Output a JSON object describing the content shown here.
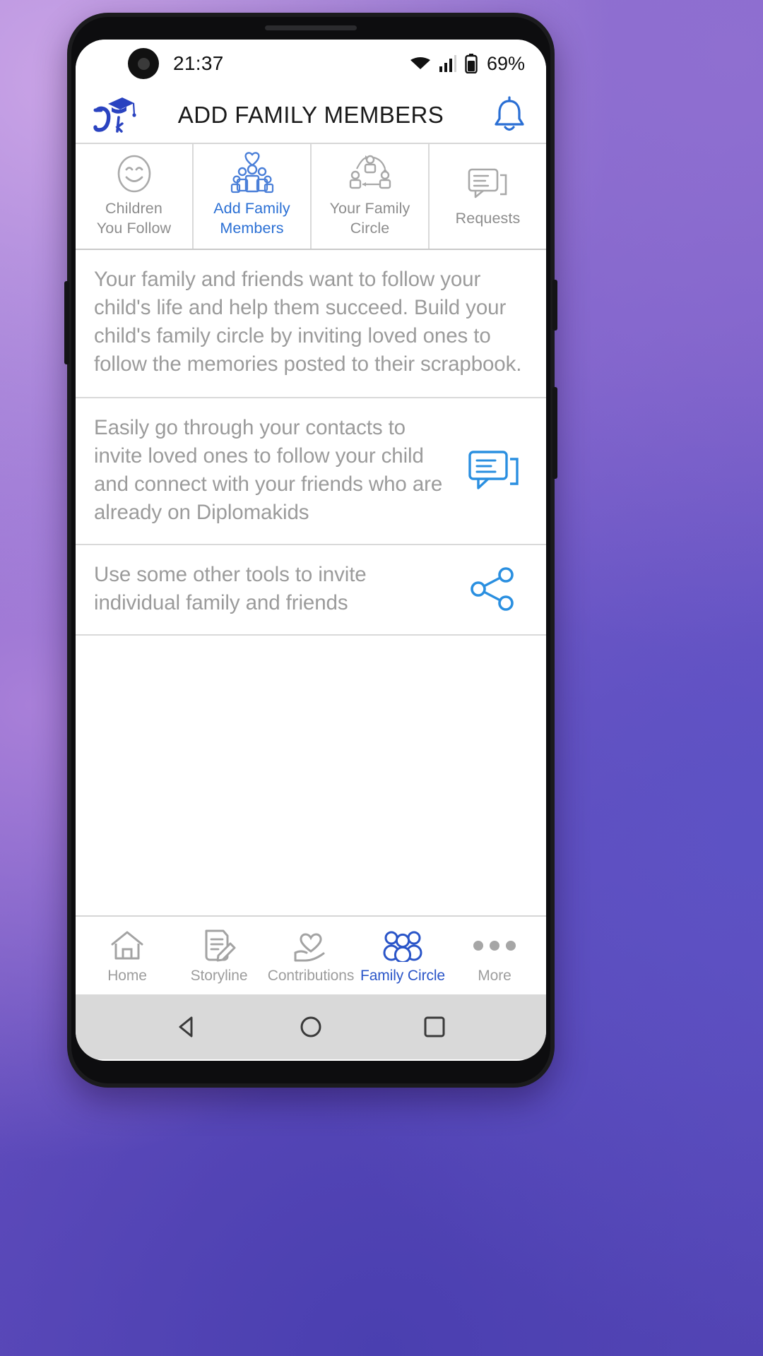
{
  "statusbar": {
    "time": "21:37",
    "battery_percent": "69%",
    "icons": [
      "wifi-icon",
      "cellular-signal-icon",
      "battery-icon"
    ]
  },
  "header": {
    "logo_name": "diplomakids-logo",
    "logo_text": "Dk",
    "title": "ADD FAMILY MEMBERS",
    "bell_icon": "notification-bell-icon"
  },
  "tabs": [
    {
      "label": "Children\nYou Follow",
      "icon": "smiley-face-icon",
      "active": false
    },
    {
      "label": "Add Family\nMembers",
      "icon": "family-heart-icon",
      "active": true
    },
    {
      "label": "Your Family\nCircle",
      "icon": "family-circle-network-icon",
      "active": false
    },
    {
      "label": "Requests",
      "icon": "chat-bubbles-icon",
      "active": false
    }
  ],
  "cards": [
    {
      "text": "Your family and friends want to follow your child's life and help them succeed. Build your child's family circle by inviting loved ones to follow the memories posted to their scrapbook.",
      "icon": null
    },
    {
      "text": "Easily go through your contacts to invite loved ones to follow your child and connect with your friends who are already on Diplomakids",
      "icon": "chat-bubbles-icon"
    },
    {
      "text": "Use some other tools to invite individual family and friends",
      "icon": "share-nodes-icon"
    }
  ],
  "bottom_nav": [
    {
      "label": "Home",
      "icon": "home-icon",
      "active": false
    },
    {
      "label": "Storyline",
      "icon": "document-pencil-icon",
      "active": false
    },
    {
      "label": "Contributions",
      "icon": "heart-hand-icon",
      "active": false
    },
    {
      "label": "Family Circle",
      "icon": "people-group-icon",
      "active": true
    },
    {
      "label": "More",
      "icon": "more-dots-icon",
      "active": false
    }
  ],
  "system_nav": {
    "back": "back-triangle-icon",
    "home": "home-circle-icon",
    "recents": "recents-square-icon"
  },
  "colors": {
    "accent_blue": "#2a6fd4",
    "nav_active": "#2a55c8",
    "muted_text": "#9b9b9b",
    "logo_blue": "#2a43c0"
  }
}
